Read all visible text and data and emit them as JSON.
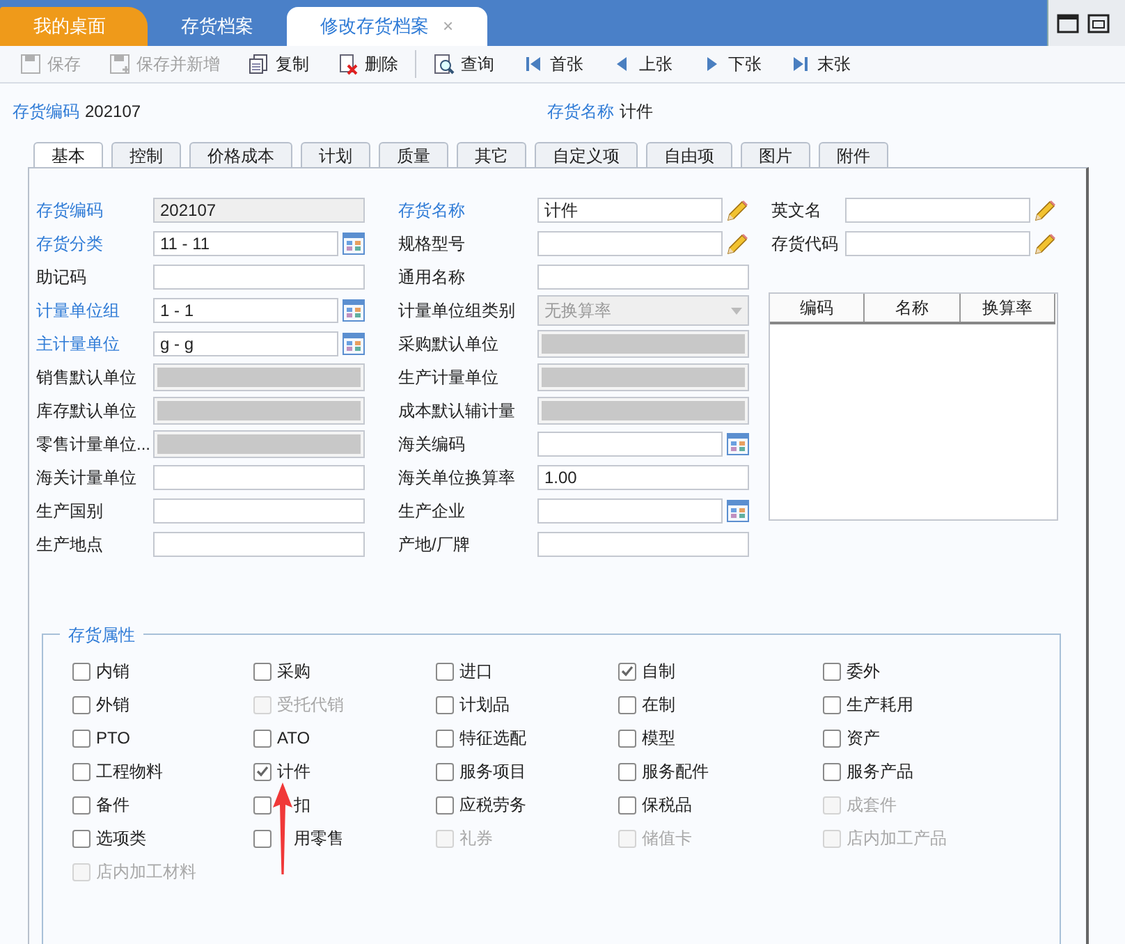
{
  "window_tabs": [
    {
      "label": "我的桌面",
      "kind": "home",
      "selected": false
    },
    {
      "label": "存货档案",
      "kind": "plain",
      "selected": false
    },
    {
      "label": "修改存货档案",
      "kind": "plain",
      "selected": true,
      "close": "×"
    }
  ],
  "toolbar": [
    {
      "label": "保存",
      "disabled": true
    },
    {
      "label": "保存并新增",
      "disabled": true
    },
    {
      "label": "复制",
      "disabled": false
    },
    {
      "label": "删除",
      "disabled": false
    },
    {
      "label": "查询",
      "disabled": false
    },
    {
      "label": "首张",
      "disabled": false
    },
    {
      "label": "上张",
      "disabled": false
    },
    {
      "label": "下张",
      "disabled": false
    },
    {
      "label": "末张",
      "disabled": false
    }
  ],
  "header": [
    {
      "label": "存货编码",
      "value": "202107"
    },
    {
      "label": "存货名称",
      "value": "计件"
    }
  ],
  "tabs": [
    {
      "label": "基本",
      "selected": true
    },
    {
      "label": "控制",
      "selected": false
    },
    {
      "label": "价格成本",
      "selected": false
    },
    {
      "label": "计划",
      "selected": false
    },
    {
      "label": "质量",
      "selected": false
    },
    {
      "label": "其它",
      "selected": false
    },
    {
      "label": "自定义项",
      "selected": false
    },
    {
      "label": "自由项",
      "selected": false
    },
    {
      "label": "图片",
      "selected": false
    },
    {
      "label": "附件",
      "selected": false
    }
  ],
  "left_fields": [
    {
      "label": "存货编码",
      "required": true,
      "kind": "readonly",
      "value": "202107"
    },
    {
      "label": "存货分类",
      "required": true,
      "kind": "lookup",
      "value": "11 - 11"
    },
    {
      "label": "助记码",
      "required": false,
      "kind": "text"
    },
    {
      "label": "计量单位组",
      "required": true,
      "kind": "lookup",
      "value": "1 - 1"
    },
    {
      "label": "主计量单位",
      "required": true,
      "kind": "lookup",
      "value": "g - g"
    },
    {
      "label": "销售默认单位",
      "required": false,
      "kind": "disabled"
    },
    {
      "label": "库存默认单位",
      "required": false,
      "kind": "disabled"
    },
    {
      "label": "零售计量单位...",
      "required": false,
      "kind": "disabled"
    },
    {
      "label": "海关计量单位",
      "required": false,
      "kind": "text"
    },
    {
      "label": "生产国别",
      "required": false,
      "kind": "text"
    },
    {
      "label": "生产地点",
      "required": false,
      "kind": "text"
    }
  ],
  "middle_fields": [
    {
      "label": "存货名称",
      "required": true,
      "kind": "edit",
      "value": "计件"
    },
    {
      "label": "规格型号",
      "required": false,
      "kind": "edit"
    },
    {
      "label": "通用名称",
      "required": false,
      "kind": "text"
    },
    {
      "label": "计量单位组类别",
      "required": false,
      "kind": "select",
      "value": "无换算率"
    },
    {
      "label": "采购默认单位",
      "required": false,
      "kind": "disabled"
    },
    {
      "label": "生产计量单位",
      "required": false,
      "kind": "disabled"
    },
    {
      "label": "成本默认辅计量",
      "required": false,
      "kind": "disabled"
    },
    {
      "label": "海关编码",
      "required": false,
      "kind": "lookup"
    },
    {
      "label": "海关单位换算率",
      "required": false,
      "kind": "text",
      "value": "1.00"
    },
    {
      "label": "生产企业",
      "required": false,
      "kind": "lookup"
    },
    {
      "label": "产地/厂牌",
      "required": false,
      "kind": "text"
    }
  ],
  "right_fields": [
    {
      "label": "英文名",
      "required": false,
      "kind": "edit"
    },
    {
      "label": "存货代码",
      "required": false,
      "kind": "edit"
    }
  ],
  "unit_table": {
    "columns": [
      "编码",
      "名称",
      "换算率"
    ]
  },
  "attributes": {
    "title": "存货属性",
    "items": [
      {
        "label": "内销",
        "checked": false,
        "disabled": false
      },
      {
        "label": "采购",
        "checked": false,
        "disabled": false
      },
      {
        "label": "进口",
        "checked": false,
        "disabled": false
      },
      {
        "label": "自制",
        "checked": true,
        "disabled": false
      },
      {
        "label": "委外",
        "checked": false,
        "disabled": false
      },
      {
        "label": "外销",
        "checked": false,
        "disabled": false
      },
      {
        "label": "受托代销",
        "checked": false,
        "disabled": true
      },
      {
        "label": "计划品",
        "checked": false,
        "disabled": false
      },
      {
        "label": "在制",
        "checked": false,
        "disabled": false
      },
      {
        "label": "生产耗用",
        "checked": false,
        "disabled": false
      },
      {
        "label": "PTO",
        "checked": false,
        "disabled": false
      },
      {
        "label": "ATO",
        "checked": false,
        "disabled": false
      },
      {
        "label": "特征选配",
        "checked": false,
        "disabled": false
      },
      {
        "label": "模型",
        "checked": false,
        "disabled": false
      },
      {
        "label": "资产",
        "checked": false,
        "disabled": false
      },
      {
        "label": "工程物料",
        "checked": false,
        "disabled": false
      },
      {
        "label": "计件",
        "checked": true,
        "disabled": false
      },
      {
        "label": "服务项目",
        "checked": false,
        "disabled": false
      },
      {
        "label": "服务配件",
        "checked": false,
        "disabled": false
      },
      {
        "label": "服务产品",
        "checked": false,
        "disabled": false
      },
      {
        "label": "备件",
        "checked": false,
        "disabled": false
      },
      {
        "label": "扣",
        "checked": false,
        "disabled": false,
        "partly_covered": true
      },
      {
        "label": "应税劳务",
        "checked": false,
        "disabled": false
      },
      {
        "label": "保税品",
        "checked": false,
        "disabled": false
      },
      {
        "label": "成套件",
        "checked": false,
        "disabled": true
      },
      {
        "label": "选项类",
        "checked": false,
        "disabled": false
      },
      {
        "label": "用零售",
        "checked": false,
        "disabled": false,
        "partly_covered": true
      },
      {
        "label": "礼券",
        "checked": false,
        "disabled": true
      },
      {
        "label": "储值卡",
        "checked": false,
        "disabled": true
      },
      {
        "label": "店内加工产品",
        "checked": false,
        "disabled": true
      },
      {
        "label": "店内加工材料",
        "checked": false,
        "disabled": true
      }
    ]
  }
}
